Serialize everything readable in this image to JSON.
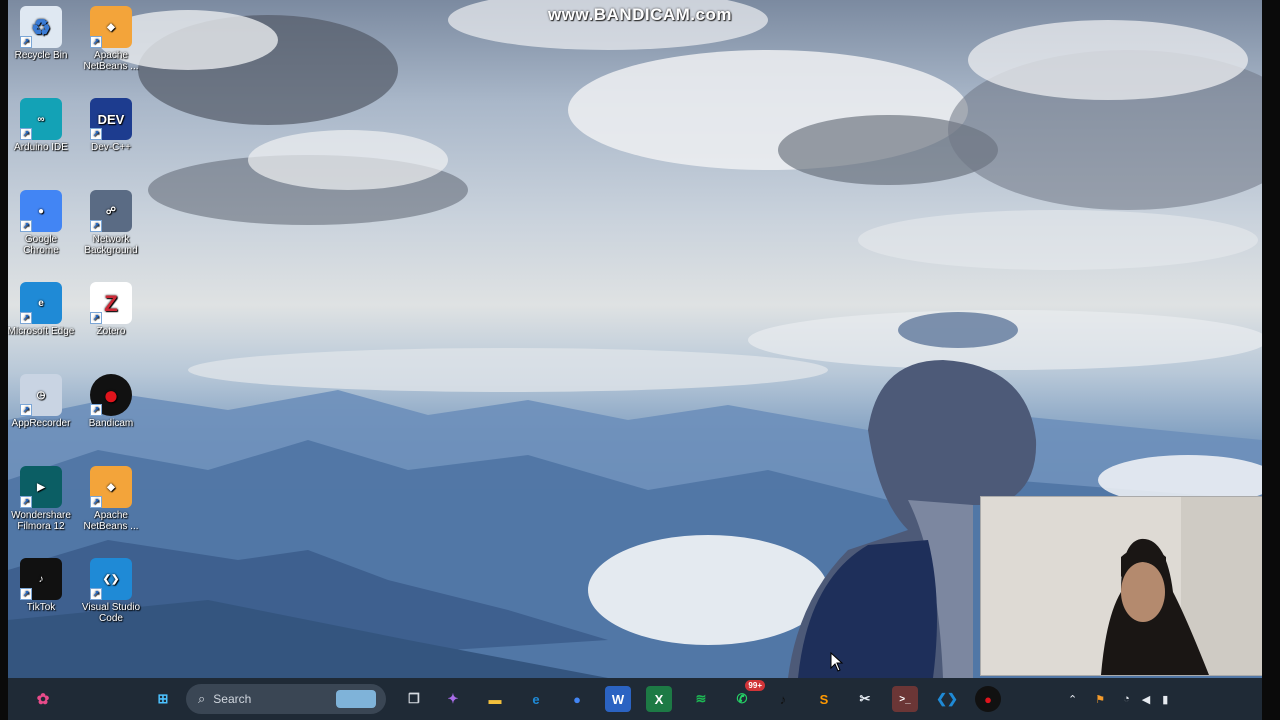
{
  "watermark": "www.BANDICAM.com",
  "desktop": {
    "icons": [
      {
        "name": "recycle-bin",
        "label": "Recycle Bin",
        "icon": "recycle-icon",
        "color": "#dfe8f2"
      },
      {
        "name": "apache-netbeans-1",
        "label": "Apache NetBeans ...",
        "icon": "netbeans-icon",
        "color": "#f3a43a"
      },
      {
        "name": "arduino-ide",
        "label": "Arduino IDE",
        "icon": "arduino-icon",
        "color": "#13a2b6"
      },
      {
        "name": "dev-cpp",
        "label": "Dev-C++",
        "icon": "devcpp-icon",
        "color": "#1d3c8f"
      },
      {
        "name": "google-chrome",
        "label": "Google Chrome",
        "icon": "chrome-icon",
        "color": "#4285f4"
      },
      {
        "name": "network-app",
        "label": "Network Background",
        "icon": "network-icon",
        "color": "#5a6b84"
      },
      {
        "name": "microsoft-edge",
        "label": "Microsoft Edge",
        "icon": "edge-icon",
        "color": "#1f8ad6"
      },
      {
        "name": "zotero",
        "label": "Zotero",
        "icon": "zotero-icon",
        "color": "#cc2936"
      },
      {
        "name": "app-clock",
        "label": "AppRecorder",
        "icon": "clock-icon",
        "color": "#c9d4e3"
      },
      {
        "name": "bandicam",
        "label": "Bandicam",
        "icon": "record-icon",
        "color": "#e0141c"
      },
      {
        "name": "wondershare-filmora",
        "label": "Wondershare Filmora 12",
        "icon": "filmora-icon",
        "color": "#0b5e64"
      },
      {
        "name": "apache-netbeans-2",
        "label": "Apache NetBeans ...",
        "icon": "netbeans-icon",
        "color": "#f3a43a"
      },
      {
        "name": "tiktok",
        "label": "TikTok",
        "icon": "tiktok-icon",
        "color": "#111111"
      },
      {
        "name": "vscode",
        "label": "Visual Studio Code",
        "icon": "vscode-icon",
        "color": "#1f8ad6"
      }
    ]
  },
  "taskbar": {
    "search_placeholder": "Search",
    "apps": [
      {
        "name": "start-button",
        "icon": "windows-icon",
        "color": "#4cc2ff"
      },
      {
        "name": "task-view",
        "icon": "task-view-icon",
        "color": "#d7dce2"
      },
      {
        "name": "copilot",
        "icon": "copilot-icon",
        "color": "#a86ce8"
      },
      {
        "name": "file-explorer",
        "icon": "folder-icon",
        "color": "#f3c03c"
      },
      {
        "name": "edge",
        "icon": "edge-icon",
        "color": "#1f8ad6"
      },
      {
        "name": "chrome",
        "icon": "chrome-icon",
        "color": "#4285f4"
      },
      {
        "name": "word",
        "icon": "word-icon",
        "color": "#2b63c2"
      },
      {
        "name": "excel",
        "icon": "excel-icon",
        "color": "#1d7a45"
      },
      {
        "name": "spotify",
        "icon": "spotify-icon",
        "color": "#1db954"
      },
      {
        "name": "whatsapp",
        "icon": "whatsapp-icon",
        "color": "#25d366",
        "badge": "99+"
      },
      {
        "name": "tiktok",
        "icon": "tiktok-icon",
        "color": "#111111"
      },
      {
        "name": "sublime",
        "icon": "sublime-icon",
        "color": "#ff9800"
      },
      {
        "name": "snipping",
        "icon": "snip-icon",
        "color": "#e8eef5"
      },
      {
        "name": "terminal",
        "icon": "terminal-icon",
        "color": "#2c2c2c"
      },
      {
        "name": "vscode",
        "icon": "vscode-icon",
        "color": "#1f8ad6"
      },
      {
        "name": "bandicam",
        "icon": "record-icon",
        "color": "#e0141c"
      }
    ]
  }
}
